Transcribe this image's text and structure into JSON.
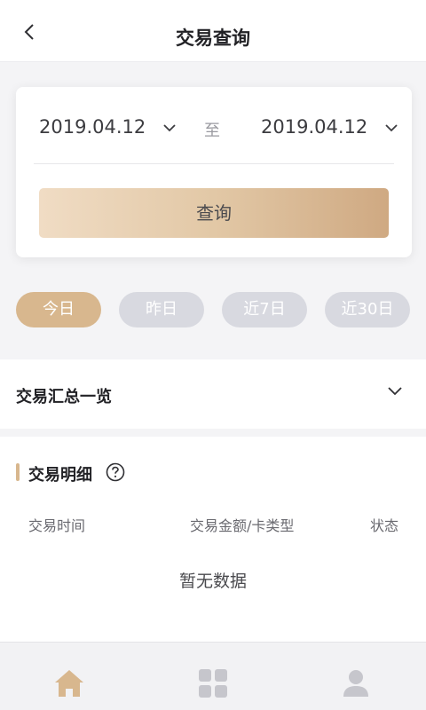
{
  "header": {
    "title": "交易查询",
    "back_icon": "chevron-left-icon"
  },
  "query": {
    "start_date": "2019.04.12",
    "separator": "至",
    "end_date": "2019.04.12",
    "button_label": "查询"
  },
  "quick_ranges": [
    {
      "label": "今日",
      "active": true
    },
    {
      "label": "昨日",
      "active": false
    },
    {
      "label": "近7日",
      "active": false
    },
    {
      "label": "近30日",
      "active": false
    }
  ],
  "summary": {
    "label": "交易汇总一览"
  },
  "detail": {
    "label": "交易明细",
    "columns": [
      "交易时间",
      "交易金额/卡类型",
      "状态"
    ],
    "empty_text": "暂无数据"
  },
  "tabbar": {
    "items": [
      {
        "icon": "home-icon",
        "active": true
      },
      {
        "icon": "grid-icon",
        "active": false
      },
      {
        "icon": "user-icon",
        "active": false
      }
    ]
  },
  "colors": {
    "accent": "#d8b78e",
    "chip_inactive": "#d8d9e0",
    "button_gradient_start": "#f0dcc4",
    "button_gradient_end": "#cfa982"
  }
}
